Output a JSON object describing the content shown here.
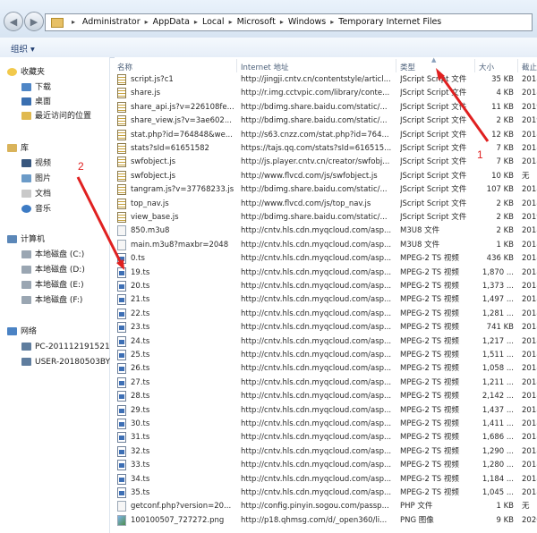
{
  "address": {
    "crumbs": [
      "Administrator",
      "AppData",
      "Local",
      "Microsoft",
      "Windows",
      "Temporary Internet Files"
    ]
  },
  "toolbar": {
    "organize_label": "组织 ▾"
  },
  "sidebar": {
    "favorites": {
      "label": "收藏夹",
      "items": [
        "下载",
        "桌面",
        "最近访问的位置"
      ]
    },
    "library": {
      "label": "库",
      "items": [
        "视频",
        "图片",
        "文档",
        "音乐"
      ]
    },
    "computer": {
      "label": "计算机",
      "items": [
        "本地磁盘 (C:)",
        "本地磁盘 (D:)",
        "本地磁盘 (E:)",
        "本地磁盘 (F:)"
      ]
    },
    "network": {
      "label": "网络",
      "items": [
        "PC-201112191521",
        "USER-20180503BY"
      ]
    }
  },
  "columns": {
    "name": "名称",
    "address": "Internet 地址",
    "type": "类型",
    "size": "大小",
    "date": "截止"
  },
  "annotations": {
    "label1": "1",
    "label2": "2",
    "arrow_color": "#e02020"
  },
  "files": [
    {
      "name": "script.js?c1",
      "addr": "http://jingji.cntv.cn/contentstyle/articl...",
      "type": "JScript Script 文件",
      "size": "35 KB",
      "date": "2018",
      "icon": "js"
    },
    {
      "name": "share.js",
      "addr": "http://r.img.cctvpic.com/library/conte...",
      "type": "JScript Script 文件",
      "size": "4 KB",
      "date": "2018",
      "icon": "js"
    },
    {
      "name": "share_api.js?v=226108fe...",
      "addr": "http://bdimg.share.baidu.com/static/...",
      "type": "JScript Script 文件",
      "size": "11 KB",
      "date": "2019",
      "icon": "js"
    },
    {
      "name": "share_view.js?v=3ae602...",
      "addr": "http://bdimg.share.baidu.com/static/...",
      "type": "JScript Script 文件",
      "size": "2 KB",
      "date": "2019",
      "icon": "js"
    },
    {
      "name": "stat.php?id=764848&we...",
      "addr": "http://s63.cnzz.com/stat.php?id=764...",
      "type": "JScript Script 文件",
      "size": "12 KB",
      "date": "2018",
      "icon": "js"
    },
    {
      "name": "stats?sId=61651582",
      "addr": "https://tajs.qq.com/stats?sId=616515...",
      "type": "JScript Script 文件",
      "size": "7 KB",
      "date": "2018",
      "icon": "js"
    },
    {
      "name": "swfobject.js",
      "addr": "http://js.player.cntv.cn/creator/swfobj...",
      "type": "JScript Script 文件",
      "size": "7 KB",
      "date": "2018",
      "icon": "js"
    },
    {
      "name": "swfobject.js",
      "addr": "http://www.flvcd.com/js/swfobject.js",
      "type": "JScript Script 文件",
      "size": "10 KB",
      "date": "无",
      "icon": "js"
    },
    {
      "name": "tangram.js?v=37768233.js",
      "addr": "http://bdimg.share.baidu.com/static/...",
      "type": "JScript Script 文件",
      "size": "107 KB",
      "date": "2018",
      "icon": "js"
    },
    {
      "name": "top_nav.js",
      "addr": "http://www.flvcd.com/js/top_nav.js",
      "type": "JScript Script 文件",
      "size": "2 KB",
      "date": "2018",
      "icon": "js"
    },
    {
      "name": "view_base.js",
      "addr": "http://bdimg.share.baidu.com/static/...",
      "type": "JScript Script 文件",
      "size": "2 KB",
      "date": "2019",
      "icon": "js"
    },
    {
      "name": "850.m3u8",
      "addr": "http://cntv.hls.cdn.myqcloud.com/asp...",
      "type": "M3U8 文件",
      "size": "2 KB",
      "date": "2018",
      "icon": "m3u"
    },
    {
      "name": "main.m3u8?maxbr=2048",
      "addr": "http://cntv.hls.cdn.myqcloud.com/asp...",
      "type": "M3U8 文件",
      "size": "1 KB",
      "date": "2018",
      "icon": "m3u"
    },
    {
      "name": "0.ts",
      "addr": "http://cntv.hls.cdn.myqcloud.com/asp...",
      "type": "MPEG-2 TS 视频",
      "size": "436 KB",
      "date": "2018",
      "icon": "ts"
    },
    {
      "name": "19.ts",
      "addr": "http://cntv.hls.cdn.myqcloud.com/asp...",
      "type": "MPEG-2 TS 视频",
      "size": "1,870 ...",
      "date": "2018",
      "icon": "ts"
    },
    {
      "name": "20.ts",
      "addr": "http://cntv.hls.cdn.myqcloud.com/asp...",
      "type": "MPEG-2 TS 视频",
      "size": "1,373 ...",
      "date": "2018",
      "icon": "ts"
    },
    {
      "name": "21.ts",
      "addr": "http://cntv.hls.cdn.myqcloud.com/asp...",
      "type": "MPEG-2 TS 视频",
      "size": "1,497 ...",
      "date": "2018",
      "icon": "ts"
    },
    {
      "name": "22.ts",
      "addr": "http://cntv.hls.cdn.myqcloud.com/asp...",
      "type": "MPEG-2 TS 视频",
      "size": "1,281 ...",
      "date": "2018",
      "icon": "ts"
    },
    {
      "name": "23.ts",
      "addr": "http://cntv.hls.cdn.myqcloud.com/asp...",
      "type": "MPEG-2 TS 视频",
      "size": "741 KB",
      "date": "2018",
      "icon": "ts"
    },
    {
      "name": "24.ts",
      "addr": "http://cntv.hls.cdn.myqcloud.com/asp...",
      "type": "MPEG-2 TS 视频",
      "size": "1,217 ...",
      "date": "2018",
      "icon": "ts"
    },
    {
      "name": "25.ts",
      "addr": "http://cntv.hls.cdn.myqcloud.com/asp...",
      "type": "MPEG-2 TS 视频",
      "size": "1,511 ...",
      "date": "2018",
      "icon": "ts"
    },
    {
      "name": "26.ts",
      "addr": "http://cntv.hls.cdn.myqcloud.com/asp...",
      "type": "MPEG-2 TS 视频",
      "size": "1,058 ...",
      "date": "2018",
      "icon": "ts"
    },
    {
      "name": "27.ts",
      "addr": "http://cntv.hls.cdn.myqcloud.com/asp...",
      "type": "MPEG-2 TS 视频",
      "size": "1,211 ...",
      "date": "2018",
      "icon": "ts"
    },
    {
      "name": "28.ts",
      "addr": "http://cntv.hls.cdn.myqcloud.com/asp...",
      "type": "MPEG-2 TS 视频",
      "size": "2,142 ...",
      "date": "2018",
      "icon": "ts"
    },
    {
      "name": "29.ts",
      "addr": "http://cntv.hls.cdn.myqcloud.com/asp...",
      "type": "MPEG-2 TS 视频",
      "size": "1,437 ...",
      "date": "2018",
      "icon": "ts"
    },
    {
      "name": "30.ts",
      "addr": "http://cntv.hls.cdn.myqcloud.com/asp...",
      "type": "MPEG-2 TS 视频",
      "size": "1,411 ...",
      "date": "2018",
      "icon": "ts"
    },
    {
      "name": "31.ts",
      "addr": "http://cntv.hls.cdn.myqcloud.com/asp...",
      "type": "MPEG-2 TS 视频",
      "size": "1,686 ...",
      "date": "2018",
      "icon": "ts"
    },
    {
      "name": "32.ts",
      "addr": "http://cntv.hls.cdn.myqcloud.com/asp...",
      "type": "MPEG-2 TS 视频",
      "size": "1,290 ...",
      "date": "2018",
      "icon": "ts"
    },
    {
      "name": "33.ts",
      "addr": "http://cntv.hls.cdn.myqcloud.com/asp...",
      "type": "MPEG-2 TS 视频",
      "size": "1,280 ...",
      "date": "2018",
      "icon": "ts"
    },
    {
      "name": "34.ts",
      "addr": "http://cntv.hls.cdn.myqcloud.com/asp...",
      "type": "MPEG-2 TS 视频",
      "size": "1,184 ...",
      "date": "2018",
      "icon": "ts"
    },
    {
      "name": "35.ts",
      "addr": "http://cntv.hls.cdn.myqcloud.com/asp...",
      "type": "MPEG-2 TS 视频",
      "size": "1,045 ...",
      "date": "2018",
      "icon": "ts"
    },
    {
      "name": "getconf.php?version=20...",
      "addr": "http://config.pinyin.sogou.com/passp...",
      "type": "PHP 文件",
      "size": "1 KB",
      "date": "无",
      "icon": "php"
    },
    {
      "name": "100100507_727272.png",
      "addr": "http://p18.qhmsg.com/d/_open360/li...",
      "type": "PNG 图像",
      "size": "9 KB",
      "date": "2020",
      "icon": "png"
    }
  ]
}
